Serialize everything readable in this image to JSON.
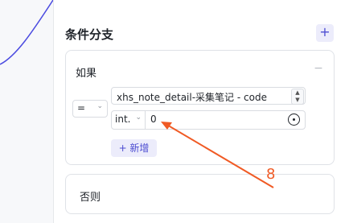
{
  "top_clip_text": "…………… ……",
  "section": {
    "title": "条件分支",
    "add_icon": "+"
  },
  "if_branch": {
    "title": "如果",
    "collapse_icon": "−",
    "operator": {
      "value": "=",
      "chevron": "⌄"
    },
    "field": {
      "value": "xhs_note_detail-采集笔记 - code",
      "chevron": "⌄"
    },
    "stepper": {
      "up": "▲",
      "down": "▼"
    },
    "value_input": {
      "type": "int.",
      "type_chevron": "⌄",
      "value": "0"
    },
    "new_button": "+ 新增"
  },
  "else_branch": {
    "title": "否则"
  },
  "annotation": {
    "label": "8",
    "color": "#f05a24"
  },
  "colors": {
    "accent": "#4c4cd1",
    "accent_bg": "#ececfb",
    "curve": "#4b4be0"
  }
}
